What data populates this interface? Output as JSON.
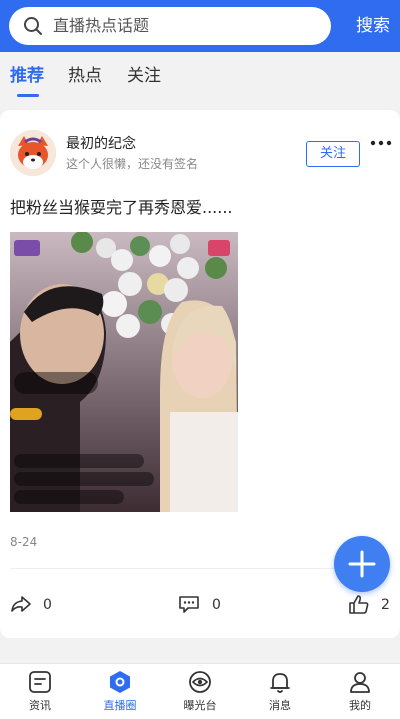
{
  "header": {
    "search_placeholder": "直播热点话题",
    "search_button": "搜索"
  },
  "tabs": [
    {
      "label": "推荐",
      "active": true
    },
    {
      "label": "热点",
      "active": false
    },
    {
      "label": "关注",
      "active": false
    }
  ],
  "post": {
    "username": "最初的纪念",
    "signature": "这个人很懒，还没有签名",
    "follow_label": "关注",
    "text": "把粉丝当猴耍完了再秀恩爱......",
    "date": "8-24",
    "share_count": "0",
    "comment_count": "0",
    "like_count": "2"
  },
  "bottom_nav": [
    {
      "label": "资讯",
      "icon": "news-icon",
      "active": false
    },
    {
      "label": "直播圈",
      "icon": "live-circle-icon",
      "active": true
    },
    {
      "label": "曝光台",
      "icon": "eye-icon",
      "active": false
    },
    {
      "label": "消息",
      "icon": "bell-icon",
      "active": false
    },
    {
      "label": "我的",
      "icon": "user-icon",
      "active": false
    }
  ],
  "colors": {
    "accent": "#2f6cf0",
    "fab": "#3f7ff2",
    "background": "#f2f2f2"
  }
}
